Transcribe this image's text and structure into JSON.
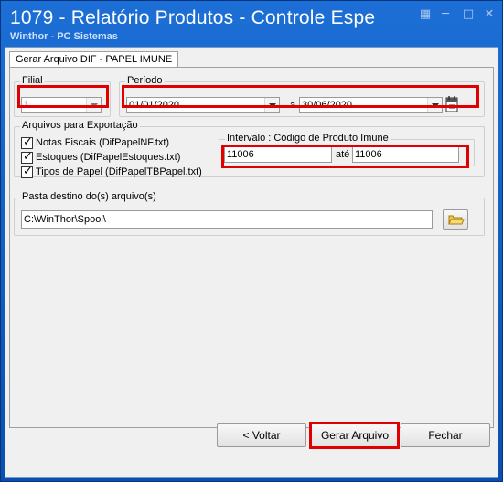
{
  "window": {
    "title": "1079 - Relatório Produtos - Controle Espe",
    "subtitle": "Winthor - PC Sistemas"
  },
  "tab": {
    "label": "Gerar Arquivo DIF - PAPEL IMUNE"
  },
  "filial": {
    "label": "Filial",
    "value": "1"
  },
  "periodo": {
    "label": "Período",
    "start": "01/01/2020",
    "separator": "a",
    "end": "30/06/2020"
  },
  "arquivos": {
    "label": "Arquivos para Exportação",
    "items": [
      {
        "label": "Notas Fiscais (DifPapelNF.txt)",
        "checked": true
      },
      {
        "label": "Estoques (DifPapelEstoques.txt)",
        "checked": true
      },
      {
        "label": "Tipos de Papel (DifPapelTBPapel.txt)",
        "checked": true
      }
    ]
  },
  "intervalo": {
    "label": "Intervalo : Código de Produto Imune",
    "from": "11006",
    "separator": "até",
    "to": "11006"
  },
  "pasta": {
    "label": "Pasta destino do(s) arquivo(s)",
    "value": "C:\\WinThor\\Spool\\"
  },
  "buttons": {
    "back": "< Voltar",
    "generate": "Gerar Arquivo",
    "close": "Fechar"
  },
  "colors": {
    "highlight": "#e00000",
    "titlebar": "#1c6fd6"
  }
}
